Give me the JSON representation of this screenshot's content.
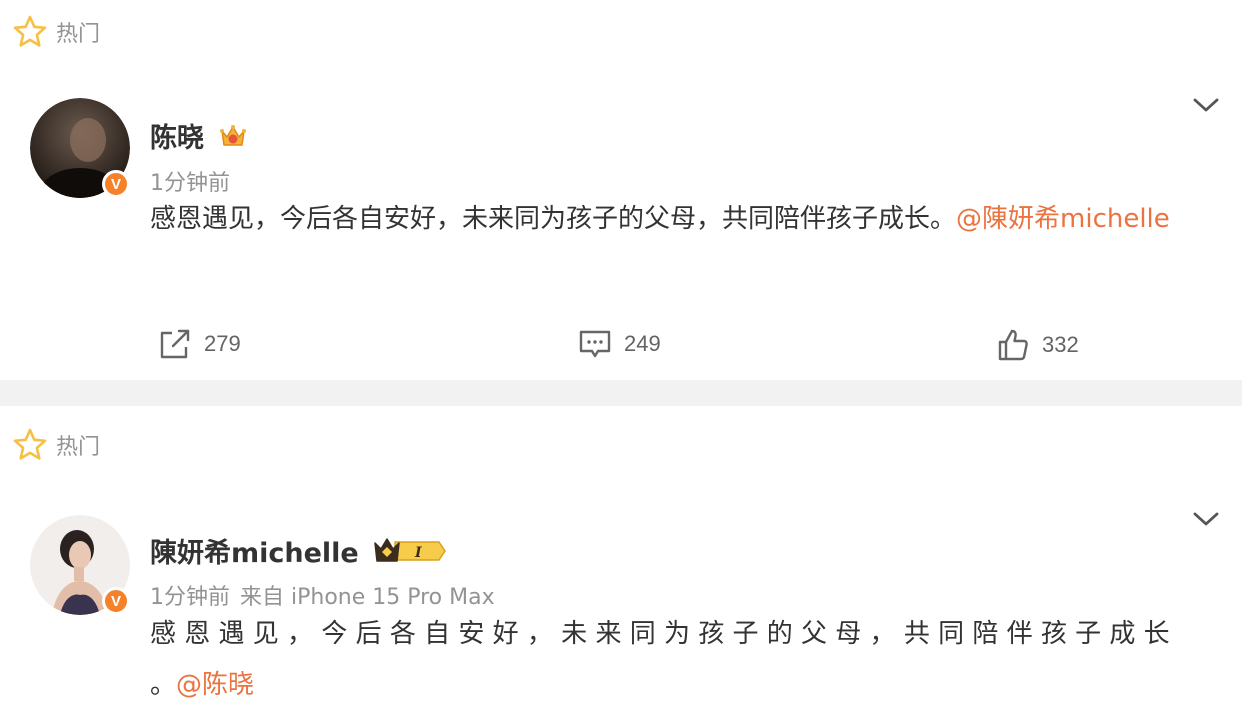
{
  "posts": [
    {
      "hot_label": "热门",
      "author": "陈晓",
      "meta_time": "1分钟前",
      "meta_source": "",
      "content_text": "感恩遇见，今后各自安好，未来同为孩子的父母，共同陪伴孩子成长。",
      "content_mention": "@陳妍希michelle",
      "verified_badge": "V",
      "actions": {
        "repost_count": "279",
        "comment_count": "249",
        "like_count": "332"
      }
    },
    {
      "hot_label": "热门",
      "author": "陳妍希michelle",
      "meta_time": "1分钟前",
      "meta_source": "来自 iPhone 15 Pro Max",
      "content_text": "感 恩 遇 见 ， 今 后 各 自 安 好 ， 未 来 同 为 孩 子 的 父 母 ， 共 同 陪 伴 孩 子 成 长 。",
      "content_mention": "@陈晓",
      "verified_badge": "V",
      "vip_level": "I"
    }
  ],
  "colors": {
    "accent_orange": "#eb7340",
    "verified_orange": "#f5822a",
    "hot_star": "#f5c044",
    "secondary_text": "#939393",
    "divider": "#f2f2f2"
  },
  "icons": {
    "hot": "star-outline-icon",
    "menu": "chevron-down-icon",
    "repost": "share-arrow-icon",
    "comment": "comment-bubble-icon",
    "like": "thumbs-up-icon",
    "badge1": "crown-badge-icon",
    "badge2": "crown-vip-level-icon"
  }
}
